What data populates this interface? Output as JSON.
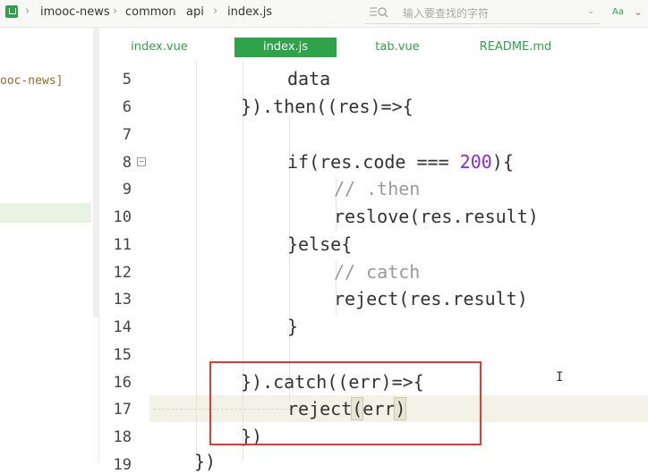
{
  "breadcrumb": {
    "items": [
      "imooc-news",
      "common",
      "api",
      "index.js"
    ],
    "separator": "›"
  },
  "search": {
    "placeholder": "输入要查找的字符",
    "match_case_label": "Aa"
  },
  "explorer": {
    "project_root": "ooc-news]"
  },
  "tabs": [
    {
      "label": "index.vue",
      "active": false
    },
    {
      "label": "index.js",
      "active": true
    },
    {
      "label": "tab.vue",
      "active": false
    },
    {
      "label": "README.md",
      "active": false
    }
  ],
  "editor": {
    "lines": [
      {
        "number": "5",
        "text": "data"
      },
      {
        "number": "6",
        "text": "}).then((res)=>{"
      },
      {
        "number": "7",
        "text": ""
      },
      {
        "number": "8",
        "text": "if(res.code === 200){"
      },
      {
        "number": "9",
        "text": "// .then"
      },
      {
        "number": "10",
        "text": "reslove(res.result)"
      },
      {
        "number": "11",
        "text": "}else{"
      },
      {
        "number": "12",
        "text": "// catch"
      },
      {
        "number": "13",
        "text": "reject(res.result)"
      },
      {
        "number": "14",
        "text": "}"
      },
      {
        "number": "15",
        "text": ""
      },
      {
        "number": "16",
        "text": "}).catch((err)=>{"
      },
      {
        "number": "17",
        "text": "reject(err)"
      },
      {
        "number": "18",
        "text": "})"
      },
      {
        "number": "19",
        "text": "})"
      }
    ],
    "highlighted_line": "17",
    "accent_color": "#2fa34a",
    "annotation_color": "#e53935",
    "number_color": "#8a2be2"
  }
}
